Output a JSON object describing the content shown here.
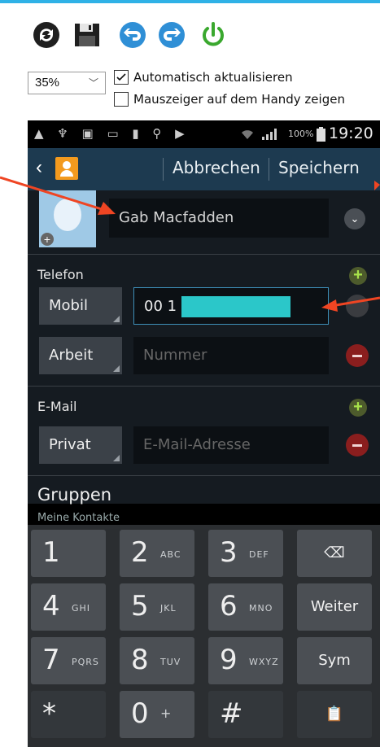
{
  "toolbar": {
    "icons": [
      "refresh-icon",
      "save-icon",
      "undo-icon",
      "redo-icon",
      "power-icon"
    ],
    "zoom": "35%",
    "auto_refresh_label": "Automatisch aktualisieren",
    "auto_refresh_checked": true,
    "show_pointer_label": "Mauszeiger auf dem Handy zeigen",
    "show_pointer_checked": false
  },
  "statusbar": {
    "left_icons": "▲ ♆ ▣ ▭ ▮ ⚲ ▶",
    "battery": "100%",
    "time": "19:20"
  },
  "actionbar": {
    "cancel_label": "Abbrechen",
    "save_label": "Speichern"
  },
  "contact": {
    "name": "Gab Macfadden"
  },
  "phone_section": {
    "title": "Telefon",
    "rows": [
      {
        "type": "Mobil",
        "value": "00 1",
        "placeholder": ""
      },
      {
        "type": "Arbeit",
        "value": "",
        "placeholder": "Nummer"
      }
    ]
  },
  "email_section": {
    "title": "E-Mail",
    "rows": [
      {
        "type": "Privat",
        "value": "",
        "placeholder": "E-Mail-Adresse"
      }
    ]
  },
  "groups": {
    "title": "Gruppen",
    "value": "Meine Kontakte"
  },
  "keyboard": {
    "rows": [
      [
        {
          "main": "1",
          "sub": ""
        },
        {
          "main": "2",
          "sub": "ABC"
        },
        {
          "main": "3",
          "sub": "DEF"
        },
        {
          "main": "⌫",
          "sub": ""
        }
      ],
      [
        {
          "main": "4",
          "sub": "GHI"
        },
        {
          "main": "5",
          "sub": "JKL"
        },
        {
          "main": "6",
          "sub": "MNO"
        },
        {
          "main": "Weiter",
          "sub": ""
        }
      ],
      [
        {
          "main": "7",
          "sub": "PQRS"
        },
        {
          "main": "8",
          "sub": "TUV"
        },
        {
          "main": "9",
          "sub": "WXYZ"
        },
        {
          "main": "Sym",
          "sub": ""
        }
      ],
      [
        {
          "main": "*",
          "sub": ""
        },
        {
          "main": "0",
          "sub": "+"
        },
        {
          "main": "#",
          "sub": ""
        },
        {
          "main": "📋",
          "sub": ""
        }
      ]
    ]
  },
  "colors": {
    "annotation_arrow": "#ef4523",
    "action_bar": "#1d3a50",
    "redaction": "#2bc7c9",
    "add_green": "#a7e34a",
    "remove_red": "#8a1e1e"
  }
}
